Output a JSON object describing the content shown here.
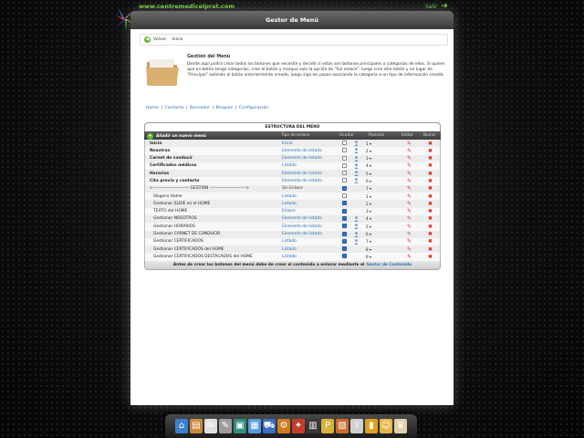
{
  "site": {
    "url": "www.centremedicelprat.com",
    "exit_label": "Salir"
  },
  "window": {
    "title": "Gestor de Menú"
  },
  "breadcrumb": {
    "back_label": "Volver",
    "current": "Inicio"
  },
  "intro": {
    "heading": "Gestión del Menú",
    "body": "Desde aquí podrá crear todos los botones que necesite y decidir si estos son botones principales o categorías de ellos. Si quiere que un botón tenga categorías, cree el botón y marque solo la opción de \"Sin enlace\", luego cree otro botón y en lugar de \"Principal\" asócielo al botón anteriormente creado, luego siga los pasos asociando la categoría a un tipo de información creada."
  },
  "nav_links": [
    "Home",
    "Contacto",
    "Buscador",
    "Bloques",
    "Configuración"
  ],
  "table": {
    "title": "ESTRUCTURA DEL MENÚ",
    "headers": {
      "add": "Añadir un nuevo menú",
      "type": "Tipo de enlace",
      "hide": "Ocultar",
      "position": "Posición",
      "edit": "Editar",
      "delete": "Borrar"
    },
    "rows": [
      {
        "name": "Inicio",
        "type": "Inicio",
        "level": "main",
        "hidden": false,
        "position": "1"
      },
      {
        "name": "Nosotros",
        "type": "Elemento de listado",
        "level": "main",
        "hidden": false,
        "position": "2"
      },
      {
        "name": "Carnet de conducir",
        "type": "Elemento de listado",
        "level": "main",
        "hidden": false,
        "position": "3"
      },
      {
        "name": "Certificados médicos",
        "type": "Listado",
        "level": "main",
        "hidden": false,
        "position": "4"
      },
      {
        "name": "Horarios",
        "type": "Elemento de listado",
        "level": "main",
        "hidden": false,
        "position": "5"
      },
      {
        "name": "Cita previa y contacto",
        "type": "Elemento de listado",
        "level": "main",
        "hidden": false,
        "position": "6"
      },
      {
        "name": "<------------------------- GESTIÓN ------------------------->",
        "type": "Sin Enlace",
        "level": "separator",
        "hidden": true,
        "position": "7"
      },
      {
        "name": "Slogans Home",
        "type": "Listado",
        "level": "sub",
        "hidden": false,
        "position": "1"
      },
      {
        "name": "Gestionar SLIDE en el HOME",
        "type": "Listado",
        "level": "sub",
        "hidden": true,
        "position": "2"
      },
      {
        "name": "TEXTO del HOME",
        "type": "Enlace",
        "level": "sub",
        "hidden": true,
        "position": "3"
      },
      {
        "name": "Gestionar NOSOTROS",
        "type": "Elemento de listado",
        "level": "sub",
        "hidden": true,
        "position": "4"
      },
      {
        "name": "Gestionar HORARIOS",
        "type": "Elemento de listado",
        "level": "sub",
        "hidden": true,
        "position": "5"
      },
      {
        "name": "Gestionar CARNET DE CONDUCIR",
        "type": "Elemento de listado",
        "level": "sub",
        "hidden": true,
        "position": "6"
      },
      {
        "name": "Gestionar CERTIFICADOS",
        "type": "Listado",
        "level": "sub",
        "hidden": true,
        "position": "7"
      },
      {
        "name": "Gestionar CERTIFICADOS del HOME",
        "type": "Listado",
        "level": "sub",
        "hidden": true,
        "position": "8"
      },
      {
        "name": "Gestionar CERTIFICADOS DESTACADOS del HOME",
        "type": "Listado",
        "level": "sub",
        "hidden": true,
        "position": "9"
      }
    ],
    "footer_text": "Antes de crear los botones del menú debe de crear el contenido a enlazar mediante el",
    "footer_link": "Gestor de Contenido"
  },
  "dock": {
    "icons": [
      "home-icon",
      "folder-icon",
      "document-icon",
      "edit-icon",
      "monitor-icon",
      "calendar-icon",
      "shop-icon",
      "gear-icon",
      "puzzle-icon",
      "newsletter-icon",
      "picture-icon",
      "presentation-icon",
      "upload-icon",
      "stats-icon",
      "user-icon",
      "trophy-icon"
    ],
    "colors": [
      "#3b7fd1",
      "#c88a3a",
      "#e0e0e0",
      "#9c9c9c",
      "#2f8f7a",
      "#5a9ae0",
      "#3c6fbf",
      "#d07a1f",
      "#c33d2e",
      "#3a3a3a",
      "#d9b23a",
      "#c76c2b",
      "#cfcfcf",
      "#e0a020",
      "#e7b64b",
      "#e0d0b0"
    ],
    "glyphs": [
      "⌂",
      "▤",
      "✉",
      "✎",
      "▣",
      "▦",
      "⛟",
      "⚙",
      "✦",
      "▥",
      "P",
      "▧",
      "⇪",
      "▮",
      "☺",
      "♛"
    ]
  }
}
